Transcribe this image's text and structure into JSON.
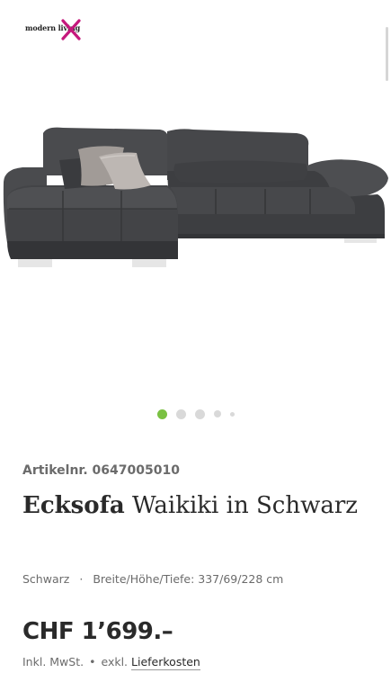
{
  "brand": {
    "name": "modern living",
    "accent": "#c5177c"
  },
  "carousel": {
    "total": 5,
    "active": 1,
    "active_color": "#7ac142"
  },
  "product": {
    "article": "Artikelnr. 0647005010",
    "title_bold": "Ecksofa",
    "title_rest": " Waikiki in Schwarz",
    "color": "Schwarz",
    "dims": "Breite/Höhe/Tiefe: 337/69/228 cm",
    "price": "CHF 1’699.–",
    "tax_incl": "Inkl. MwSt.",
    "tax_sep": "•",
    "delivery_prefix": "exkl.",
    "delivery_link": "Lieferkosten",
    "specs_sep": "·"
  }
}
